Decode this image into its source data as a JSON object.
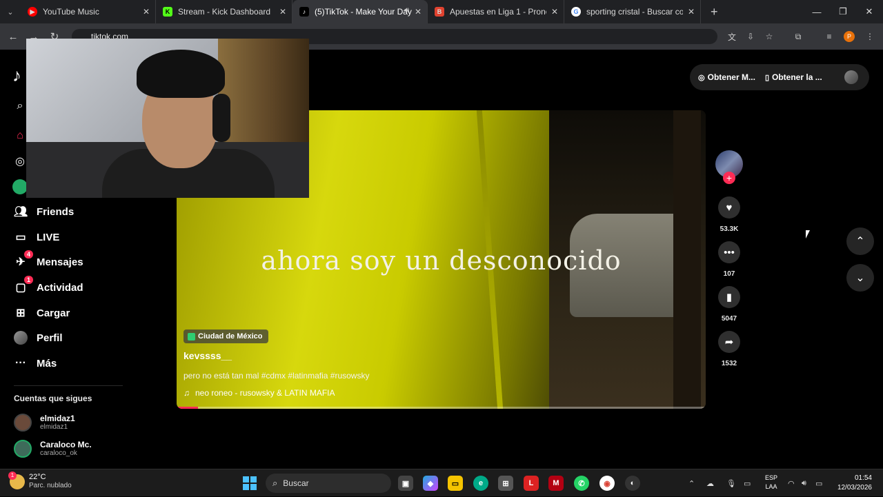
{
  "browser": {
    "tabs": [
      {
        "title": "YouTube Music",
        "icon": "youtube-music-icon",
        "color": "#ff0000"
      },
      {
        "title": "Stream - Kick Dashboard",
        "icon": "kick-icon",
        "color": "#53fc18"
      },
      {
        "title": "(5)TikTok - Make Your Day",
        "icon": "tiktok-icon",
        "color": "#ffffff"
      },
      {
        "title": "Apuestas en Liga 1 - Pronóstico",
        "icon": "betting-icon",
        "color": "#e0422f"
      },
      {
        "title": "sporting cristal - Buscar con Go",
        "icon": "google-icon",
        "color": "#4285f4"
      }
    ],
    "address": "tiktok.com",
    "profile_initial": "P"
  },
  "sidebar": {
    "nav": [
      {
        "label": "Friends",
        "icon": "friends-icon"
      },
      {
        "label": "LIVE",
        "icon": "live-icon"
      },
      {
        "label": "Mensajes",
        "icon": "messages-icon",
        "badge": "4"
      },
      {
        "label": "Actividad",
        "icon": "activity-icon",
        "badge": "1"
      },
      {
        "label": "Cargar",
        "icon": "upload-icon"
      },
      {
        "label": "Perfil",
        "icon": "profile-icon"
      },
      {
        "label": "Más",
        "icon": "more-icon"
      }
    ],
    "following_title": "Cuentas que sigues",
    "following": [
      {
        "name": "elmidaz1",
        "handle": "elmidaz1"
      },
      {
        "name": "Caraloco Mc.",
        "handle": "caraloco_ok"
      }
    ]
  },
  "video": {
    "caption": "ahora soy un desconocido",
    "location": "Ciudad de México",
    "author": "kevssss__",
    "description": "pero no está tan mal #cdmx #latinmafia #rusowsky",
    "music": "neo roneo - rusowsky & LATIN MAFIA",
    "progress": 0.04
  },
  "actions": {
    "likes": "53.3K",
    "comments": "107",
    "saves": "5047",
    "shares": "1532"
  },
  "topbar": {
    "get_coins": "Obtener M...",
    "get_app": "Obtener la ..."
  },
  "taskbar": {
    "temp": "22°C",
    "weather": "Parc. nublado",
    "weather_badge": "1",
    "search_label": "Buscar",
    "lang_1": "ESP",
    "lang_2": "LAA",
    "time": "01:54",
    "date": "12/03/2026"
  }
}
